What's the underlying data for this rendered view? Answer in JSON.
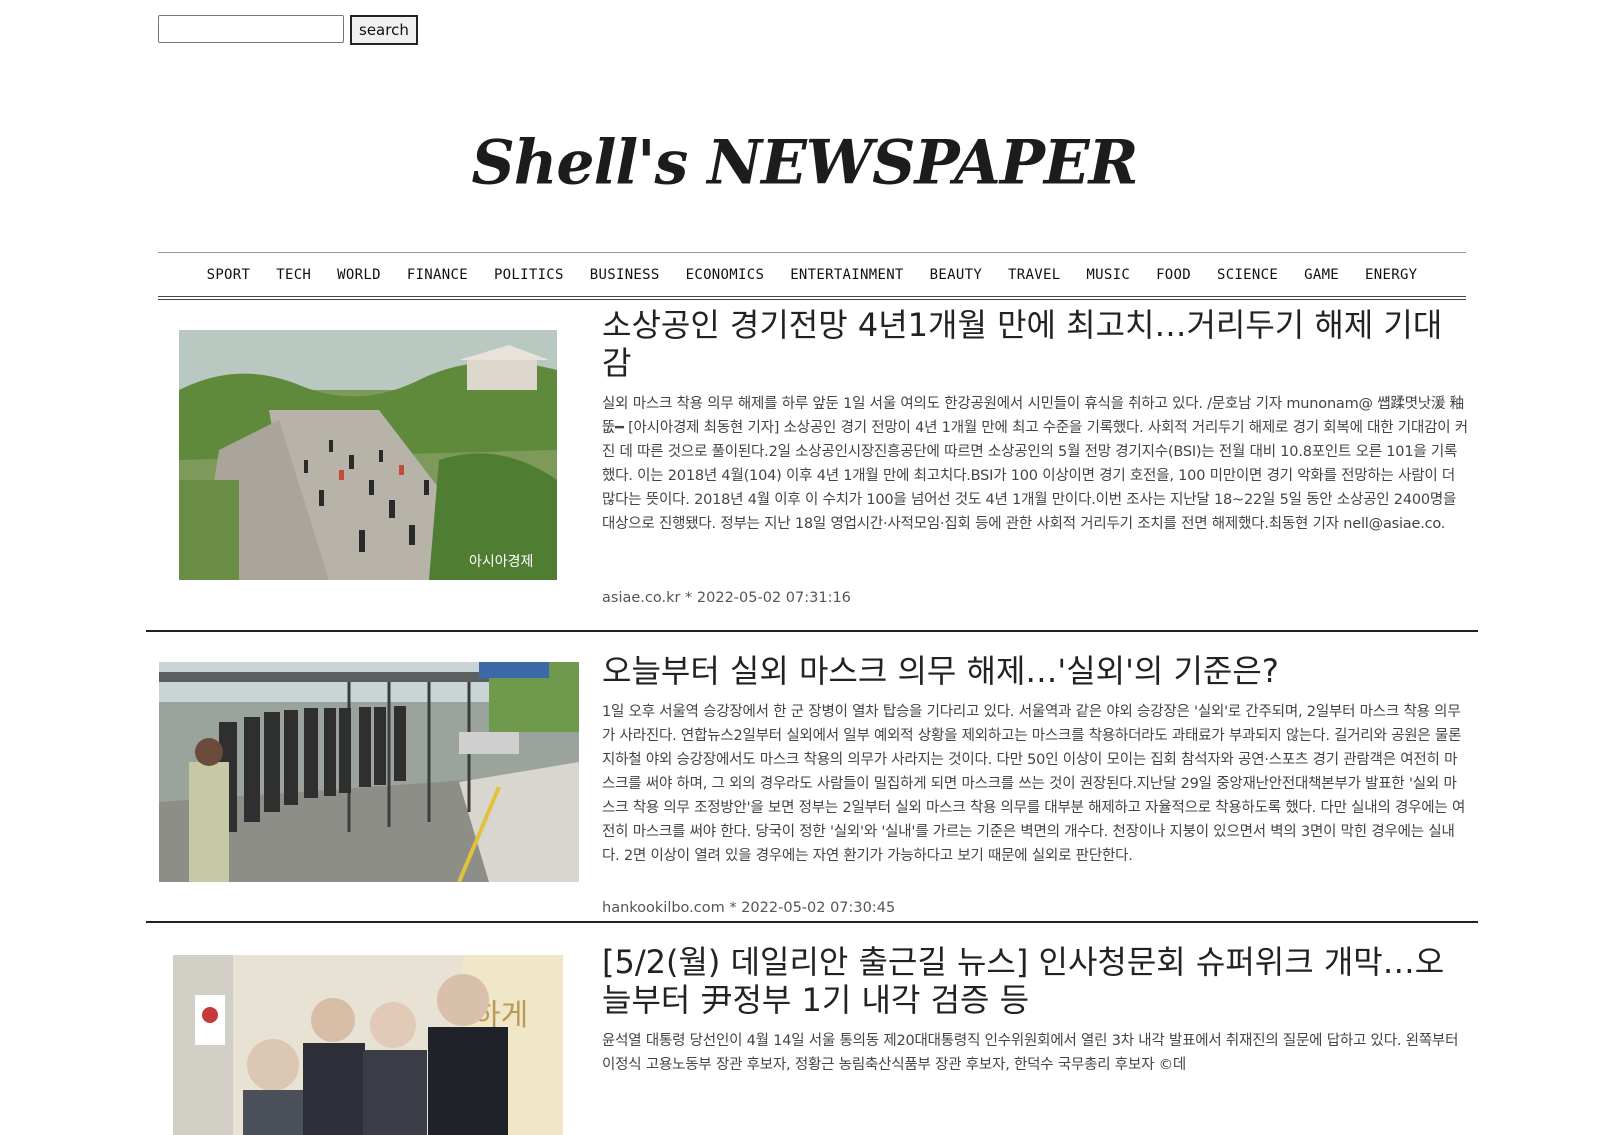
{
  "search": {
    "placeholder": "",
    "value": "",
    "button_label": "search"
  },
  "masthead": {
    "title": "Shell's NEWSPAPER"
  },
  "nav": {
    "items": [
      "SPORT",
      "TECH",
      "WORLD",
      "FINANCE",
      "POLITICS",
      "BUSINESS",
      "ECONOMICS",
      "ENTERTAINMENT",
      "BEAUTY",
      "TRAVEL",
      "MUSIC",
      "FOOD",
      "SCIENCE",
      "GAME",
      "ENERGY"
    ]
  },
  "articles": [
    {
      "title": "소상공인 경기전망 4년1개월 만에 최고치…거리두기 해제 기대감",
      "body": "실외 마스크 착용 의무 해제를 하루 앞둔 1일 서울 여의도 한강공원에서 시민들이 휴식을 취하고 있다. /문호남 기자 munonam@ 썝蹂몃낫湲 釉뚮━ [아시아경제 최동현 기자] 소상공인 경기 전망이 4년 1개월 만에 최고 수준을 기록했다. 사회적 거리두기 해제로 경기 회복에 대한 기대감이 커진 데 따른 것으로 풀이된다.2일 소상공인시장진흥공단에 따르면 소상공인의 5월 전망 경기지수(BSI)는 전월 대비 10.8포인트 오른 101을 기록했다. 이는 2018년 4월(104) 이후 4년 1개월 만에 최고치다.BSI가 100 이상이면 경기 호전을, 100 미만이면 경기 악화를 전망하는 사람이 더 많다는 뜻이다. 2018년 4월 이후 이 수치가 100을 넘어선 것도 4년 1개월 만이다.이번 조사는 지난달 18~22일 5일 동안 소상공인 2400명을 대상으로 진행됐다. 정부는 지난 18일 영업시간·사적모임·집회 등에 관한 사회적 거리두기 조치를 전면 해제했다.최동현 기자 nell@asiae.co.",
      "meta": "asiae.co.kr * 2022-05-02 07:31:16",
      "image_watermark": "아시아경제"
    },
    {
      "title": "오늘부터 실외 마스크 의무 해제…'실외'의 기준은?",
      "body": "1일 오후 서울역 승강장에서 한 군 장병이 열차 탑승을 기다리고 있다. 서울역과 같은 야외 승강장은 '실외'로 간주되며, 2일부터 마스크 착용 의무가 사라진다. 연합뉴스2일부터 실외에서 일부 예외적 상황을 제외하고는 마스크를 착용하더라도 과태료가 부과되지 않는다. 길거리와 공원은 물론 지하철 야외 승강장에서도 마스크 착용의 의무가 사라지는 것이다. 다만 50인 이상이 모이는 집회 참석자와 공연·스포츠 경기 관람객은 여전히 마스크를 써야 하며, 그 외의 경우라도 사람들이 밀집하게 되면 마스크를 쓰는 것이 권장된다.지난달 29일 중앙재난안전대책본부가 발표한 '실외 마스크 착용 의무 조정방안'을 보면 정부는 2일부터 실외 마스크 착용 의무를 대부분 해제하고 자율적으로 착용하도록 했다. 다만 실내의 경우에는 여전히 마스크를 써야 한다. 당국이 정한 '실외'와 '실내'를 가르는 기준은 벽면의 개수다. 천장이나 지붕이 있으면서 벽의 3면이 막힌 경우에는 실내다. 2면 이상이 열려 있을 경우에는 자연 환기가 가능하다고 보기 때문에 실외로 판단한다.",
      "meta": "hankookilbo.com * 2022-05-02 07:30:45"
    },
    {
      "title": "[5/2(월) 데일리안 출근길 뉴스] 인사청문회 슈퍼위크 개막…오늘부터 尹정부 1기 내각 검증 등",
      "body": "윤석열 대통령 당선인이 4월 14일 서울 통의동 제20대대통령직 인수위원회에서 열린 3차 내각 발표에서 취재진의 질문에 답하고 있다. 왼쪽부터 이정식 고용노동부 장관 후보자, 정황근 농림축산식품부 장관 후보자, 한덕수 국무총리 후보자 ©데",
      "meta": "",
      "image_text": "하게"
    }
  ]
}
